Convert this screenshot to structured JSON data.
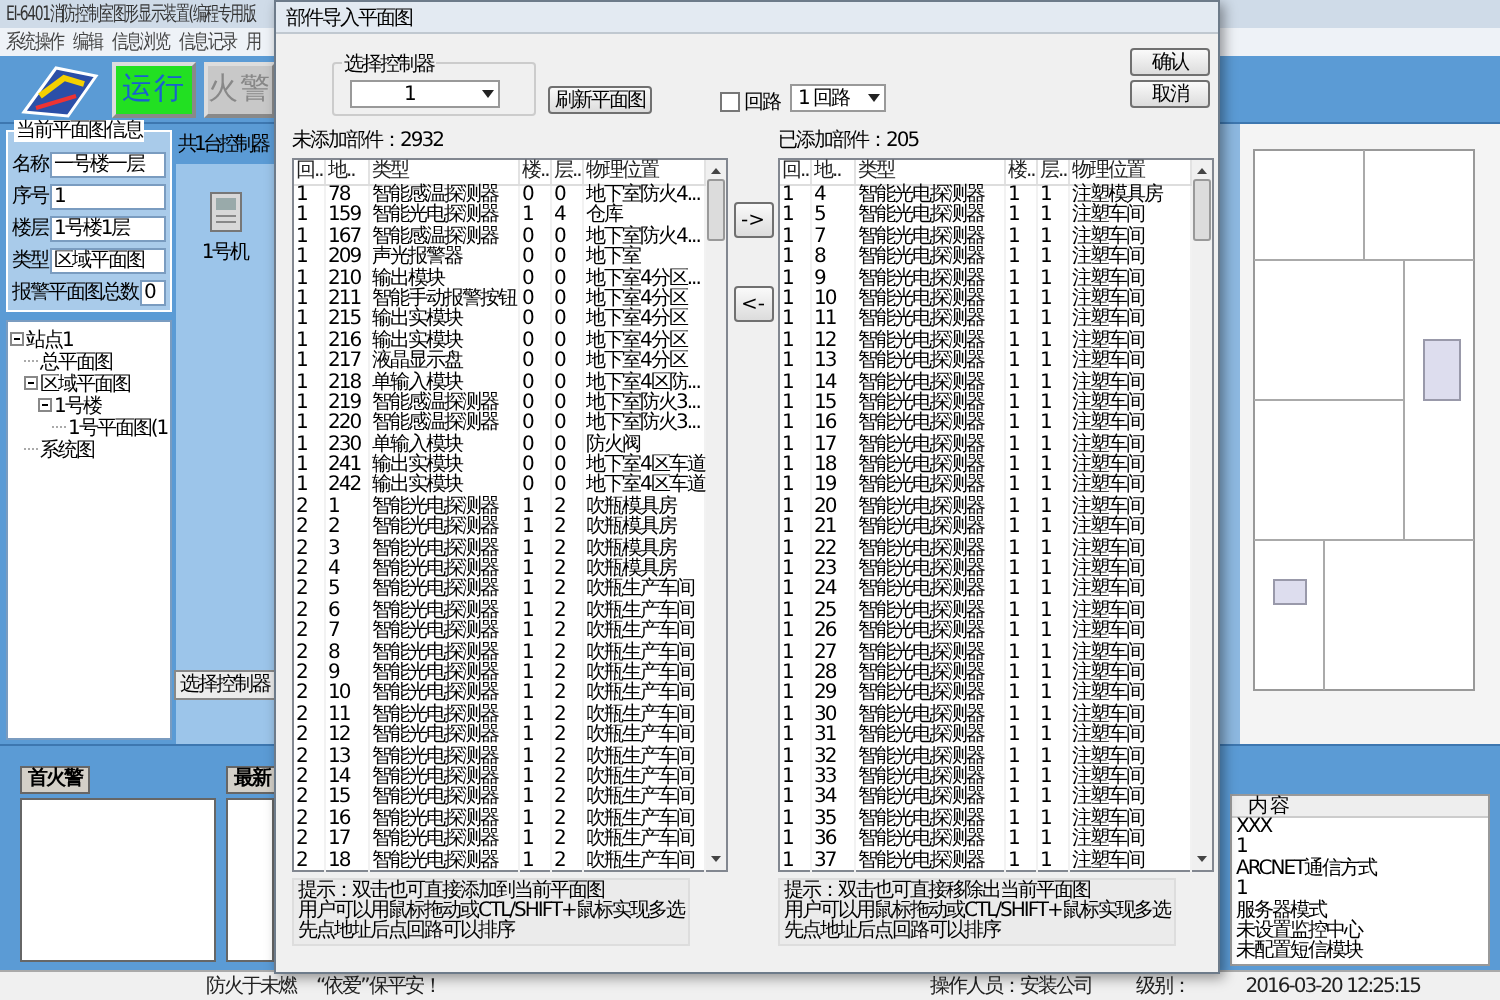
{
  "window": {
    "title": "EI-6401消防控制室图形显示装置(编程专用版"
  },
  "menu": [
    "系统操作",
    "编辑",
    "信息浏览",
    "信息记录",
    "用"
  ],
  "toolbar": {
    "run_button": "运行",
    "fire_button": "火警"
  },
  "plan_info": {
    "title": "当前平面图信息",
    "fields": [
      {
        "label": "名称",
        "value": "一号楼一层"
      },
      {
        "label": "序号",
        "value": "1"
      },
      {
        "label": "楼层",
        "value": "1号楼1层"
      },
      {
        "label": "类型",
        "value": "区域平面图"
      },
      {
        "label": "报警平面图总数",
        "value": "0"
      }
    ]
  },
  "tree": [
    {
      "label": "站点1",
      "children": [
        {
          "label": "总平面图"
        },
        {
          "label": "区域平面图",
          "children": [
            {
              "label": "1号楼",
              "children": [
                {
                  "label": "1号平面图(1"
                }
              ]
            }
          ]
        },
        {
          "label": "系统图"
        }
      ]
    }
  ],
  "controllers": {
    "title": "共1台控制器",
    "items": [
      "1号机"
    ],
    "button": "选择控制器"
  },
  "first_alarm": {
    "title": "首火警"
  },
  "latest": {
    "title": "最新"
  },
  "info_table": {
    "header": "内 容",
    "rows": [
      "XXX",
      "1",
      "ARCNET通信方式",
      "1",
      "服务器模式",
      "未设置监控中心",
      "未配置短信模块"
    ]
  },
  "status_bar": {
    "slogan": "防火于未燃",
    "motto": "“依爱”保平安！",
    "operator": "操作人员：安装公司",
    "level": "级别：",
    "time": "2016-03-20 12:25:15"
  },
  "dialog": {
    "title": "部件导入平面图",
    "controller_group": "选择控制器",
    "controller_select": "1",
    "refresh_button": "刷新平面图",
    "loop_checkbox": {
      "label": "回路",
      "checked": false
    },
    "loop_select": "1 回路",
    "confirm_button": "确认",
    "cancel_button": "取消",
    "add_button": "->",
    "remove_button": "<-",
    "unadded": {
      "count": "未添加部件：2932",
      "columns": [
        "回..",
        "地..",
        "类型",
        "楼..",
        "层..",
        "物理位置"
      ],
      "rows": [
        [
          "1",
          "78",
          "智能感温探测器",
          "0",
          "0",
          "地下室防火4..."
        ],
        [
          "1",
          "159",
          "智能光电探测器",
          "1",
          "4",
          "仓库"
        ],
        [
          "1",
          "167",
          "智能感温探测器",
          "0",
          "0",
          "地下室防火4..."
        ],
        [
          "1",
          "209",
          "声光报警器",
          "0",
          "0",
          "地下室"
        ],
        [
          "1",
          "210",
          "输出模块",
          "0",
          "0",
          "地下室4分区..."
        ],
        [
          "1",
          "211",
          "智能手动报警按钮",
          "0",
          "0",
          "地下室4分区"
        ],
        [
          "1",
          "215",
          "输出实模块",
          "0",
          "0",
          "地下室4分区"
        ],
        [
          "1",
          "216",
          "输出实模块",
          "0",
          "0",
          "地下室4分区"
        ],
        [
          "1",
          "217",
          "液晶显示盘",
          "0",
          "0",
          "地下室4分区"
        ],
        [
          "1",
          "218",
          "单输入模块",
          "0",
          "0",
          "地下室4区防..."
        ],
        [
          "1",
          "219",
          "智能感温探测器",
          "0",
          "0",
          "地下室防火3..."
        ],
        [
          "1",
          "220",
          "智能感温探测器",
          "0",
          "0",
          "地下室防火3..."
        ],
        [
          "1",
          "230",
          "单输入模块",
          "0",
          "0",
          "防火阀"
        ],
        [
          "1",
          "241",
          "输出实模块",
          "0",
          "0",
          "地下室4区车道"
        ],
        [
          "1",
          "242",
          "输出实模块",
          "0",
          "0",
          "地下室4区车道"
        ],
        [
          "2",
          "1",
          "智能光电探测器",
          "1",
          "2",
          "吹瓶模具房"
        ],
        [
          "2",
          "2",
          "智能光电探测器",
          "1",
          "2",
          "吹瓶模具房"
        ],
        [
          "2",
          "3",
          "智能光电探测器",
          "1",
          "2",
          "吹瓶模具房"
        ],
        [
          "2",
          "4",
          "智能光电探测器",
          "1",
          "2",
          "吹瓶模具房"
        ],
        [
          "2",
          "5",
          "智能光电探测器",
          "1",
          "2",
          "吹瓶生产车间"
        ],
        [
          "2",
          "6",
          "智能光电探测器",
          "1",
          "2",
          "吹瓶生产车间"
        ],
        [
          "2",
          "7",
          "智能光电探测器",
          "1",
          "2",
          "吹瓶生产车间"
        ],
        [
          "2",
          "8",
          "智能光电探测器",
          "1",
          "2",
          "吹瓶生产车间"
        ],
        [
          "2",
          "9",
          "智能光电探测器",
          "1",
          "2",
          "吹瓶生产车间"
        ],
        [
          "2",
          "10",
          "智能光电探测器",
          "1",
          "2",
          "吹瓶生产车间"
        ],
        [
          "2",
          "11",
          "智能光电探测器",
          "1",
          "2",
          "吹瓶生产车间"
        ],
        [
          "2",
          "12",
          "智能光电探测器",
          "1",
          "2",
          "吹瓶生产车间"
        ],
        [
          "2",
          "13",
          "智能光电探测器",
          "1",
          "2",
          "吹瓶生产车间"
        ],
        [
          "2",
          "14",
          "智能光电探测器",
          "1",
          "2",
          "吹瓶生产车间"
        ],
        [
          "2",
          "15",
          "智能光电探测器",
          "1",
          "2",
          "吹瓶生产车间"
        ],
        [
          "2",
          "16",
          "智能光电探测器",
          "1",
          "2",
          "吹瓶生产车间"
        ],
        [
          "2",
          "17",
          "智能光电探测器",
          "1",
          "2",
          "吹瓶生产车间"
        ],
        [
          "2",
          "18",
          "智能光电探测器",
          "1",
          "2",
          "吹瓶生产车间"
        ]
      ],
      "hints": [
        "提示：双击也可直接添加到当前平面图",
        "用户可以用鼠标拖动或CTL/SHIFT+鼠标实现多选",
        "先点地址后点回路可以排序"
      ]
    },
    "added": {
      "count": "已添加部件：205",
      "columns": [
        "回..",
        "地..",
        "类型",
        "楼..",
        "层..",
        "物理位置"
      ],
      "rows": [
        [
          "1",
          "4",
          "智能光电探测器",
          "1",
          "1",
          "注塑模具房"
        ],
        [
          "1",
          "5",
          "智能光电探测器",
          "1",
          "1",
          "注塑车间"
        ],
        [
          "1",
          "7",
          "智能光电探测器",
          "1",
          "1",
          "注塑车间"
        ],
        [
          "1",
          "8",
          "智能光电探测器",
          "1",
          "1",
          "注塑车间"
        ],
        [
          "1",
          "9",
          "智能光电探测器",
          "1",
          "1",
          "注塑车间"
        ],
        [
          "1",
          "10",
          "智能光电探测器",
          "1",
          "1",
          "注塑车间"
        ],
        [
          "1",
          "11",
          "智能光电探测器",
          "1",
          "1",
          "注塑车间"
        ],
        [
          "1",
          "12",
          "智能光电探测器",
          "1",
          "1",
          "注塑车间"
        ],
        [
          "1",
          "13",
          "智能光电探测器",
          "1",
          "1",
          "注塑车间"
        ],
        [
          "1",
          "14",
          "智能光电探测器",
          "1",
          "1",
          "注塑车间"
        ],
        [
          "1",
          "15",
          "智能光电探测器",
          "1",
          "1",
          "注塑车间"
        ],
        [
          "1",
          "16",
          "智能光电探测器",
          "1",
          "1",
          "注塑车间"
        ],
        [
          "1",
          "17",
          "智能光电探测器",
          "1",
          "1",
          "注塑车间"
        ],
        [
          "1",
          "18",
          "智能光电探测器",
          "1",
          "1",
          "注塑车间"
        ],
        [
          "1",
          "19",
          "智能光电探测器",
          "1",
          "1",
          "注塑车间"
        ],
        [
          "1",
          "20",
          "智能光电探测器",
          "1",
          "1",
          "注塑车间"
        ],
        [
          "1",
          "21",
          "智能光电探测器",
          "1",
          "1",
          "注塑车间"
        ],
        [
          "1",
          "22",
          "智能光电探测器",
          "1",
          "1",
          "注塑车间"
        ],
        [
          "1",
          "23",
          "智能光电探测器",
          "1",
          "1",
          "注塑车间"
        ],
        [
          "1",
          "24",
          "智能光电探测器",
          "1",
          "1",
          "注塑车间"
        ],
        [
          "1",
          "25",
          "智能光电探测器",
          "1",
          "1",
          "注塑车间"
        ],
        [
          "1",
          "26",
          "智能光电探测器",
          "1",
          "1",
          "注塑车间"
        ],
        [
          "1",
          "27",
          "智能光电探测器",
          "1",
          "1",
          "注塑车间"
        ],
        [
          "1",
          "28",
          "智能光电探测器",
          "1",
          "1",
          "注塑车间"
        ],
        [
          "1",
          "29",
          "智能光电探测器",
          "1",
          "1",
          "注塑车间"
        ],
        [
          "1",
          "30",
          "智能光电探测器",
          "1",
          "1",
          "注塑车间"
        ],
        [
          "1",
          "31",
          "智能光电探测器",
          "1",
          "1",
          "注塑车间"
        ],
        [
          "1",
          "32",
          "智能光电探测器",
          "1",
          "1",
          "注塑车间"
        ],
        [
          "1",
          "33",
          "智能光电探测器",
          "1",
          "1",
          "注塑车间"
        ],
        [
          "1",
          "34",
          "智能光电探测器",
          "1",
          "1",
          "注塑车间"
        ],
        [
          "1",
          "35",
          "智能光电探测器",
          "1",
          "1",
          "注塑车间"
        ],
        [
          "1",
          "36",
          "智能光电探测器",
          "1",
          "1",
          "注塑车间"
        ],
        [
          "1",
          "37",
          "智能光电探测器",
          "1",
          "1",
          "注塑车间"
        ]
      ],
      "hints": [
        "提示：双击也可直接移除出当前平面图",
        "用户可以用鼠标拖动或CTL/SHIFT+鼠标实现多选",
        "先点地址后点回路可以排序"
      ]
    }
  }
}
